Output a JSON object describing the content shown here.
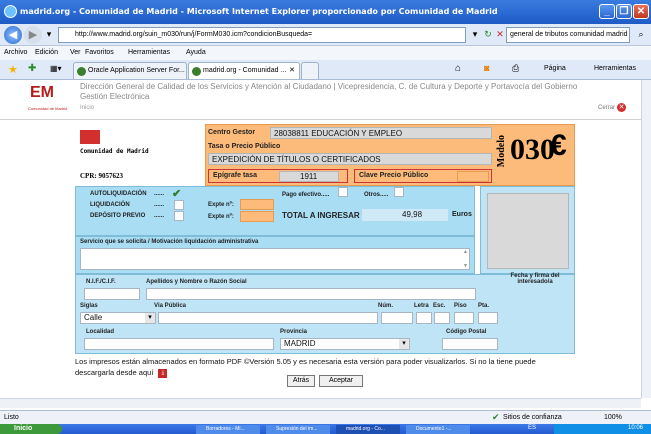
{
  "window": {
    "title": "madrid.org - Comunidad de Madrid - Microsoft Internet Explorer proporcionado por Comunidad de Madrid",
    "buttons": {
      "minimize": "_",
      "restore": "❐",
      "close": "✕"
    }
  },
  "address": {
    "url": "http://www.madrid.org/suin_m030/run/j/FormM030.icm?condicionBusqueda=",
    "search": "general de tributos comunidad madrid"
  },
  "menu": [
    "Archivo",
    "Edición",
    "Ver",
    "Favoritos",
    "Herramientas",
    "Ayuda"
  ],
  "tabs": [
    "Oracle Application Server For...",
    "madrid.org - Comunidad ..."
  ],
  "toolbar_right": {
    "pagina": "Página",
    "herramientas": "Herramientas"
  },
  "page_header": {
    "logo": "EM",
    "logo_sub": "Comunidad de Madrid",
    "dg_text": "Dirección General de Calidad de los Servicios y Atención al Ciudadano | Vicepresidencia, C. de Cultura y Deporte y Portavocía del Gobierno",
    "dg_sub": "Gestión Electrónica",
    "inicio": "Inicio",
    "cerrar": "Cerrar"
  },
  "form": {
    "comunidad": "Comunidad de Madrid",
    "cpr": "CPR: 9057623",
    "centro_gestor_label": "Centro Gestor",
    "centro_gestor_value": "28038811 EDUCACIÓN Y EMPLEO",
    "tasa_label": "Tasa o Precio Público",
    "tasa_value": "EXPEDICIÓN DE TÍTULOS O CERTIFICADOS",
    "epigrafe_label": "Epígrafe tasa",
    "epigrafe_value": "1911",
    "clave_label": "Clave Precio Público",
    "modelo_label": "Modelo",
    "modelo_num": "030",
    "euro": "€",
    "autoliq": "AUTOLIQUIDACIÓN",
    "liquidacion": "LIQUIDACIÓN",
    "deposito": "DEPÓSITO PREVIO",
    "dots": "......",
    "check": "✔",
    "expte_label": "Expte nº:",
    "pago_efectivo": "Pago efectivo.....",
    "otros": "Otros.....",
    "total_label": "TOTAL A INGRESAR",
    "total_value": "49,98",
    "euros": "Euros",
    "servicio_label": "Servicio que se solicita / Motivación liquidación administrativa",
    "nif_label": "N.I.F./C.I.F.",
    "nombre_label": "Apellidos y Nombre o Razón Social",
    "fecha_label": "Fecha y firma del interesado/a",
    "siglas_label": "Siglas",
    "via_label": "Vía Pública",
    "num_label": "Núm.",
    "letra_label": "Letra",
    "esc_label": "Esc.",
    "piso_label": "Piso",
    "pta_label": "Pta.",
    "siglas_value": "Calle",
    "localidad_label": "Localidad",
    "provincia_label": "Provincia",
    "provincia_value": "MADRID",
    "cp_label": "Código Postal"
  },
  "note": {
    "text": "Los impresos están almacenados en formato PDF ©Versión 5.05 y es necesaria esta versión para poder visualizarlos. Si no la tiene puede descargarla desde aquí"
  },
  "buttons": {
    "atras": "Atrás",
    "aceptar": "Aceptar"
  },
  "status": {
    "left": "Listo",
    "zone": "Sitios de confianza",
    "zoom": "100%"
  },
  "taskbar": {
    "start": "Inicio",
    "items": [
      "Borradores - Mi...",
      "Supresión del im...",
      "madrid.org - Co...",
      "Documento1 -..."
    ],
    "lang": "ES",
    "clock": "10:06"
  }
}
